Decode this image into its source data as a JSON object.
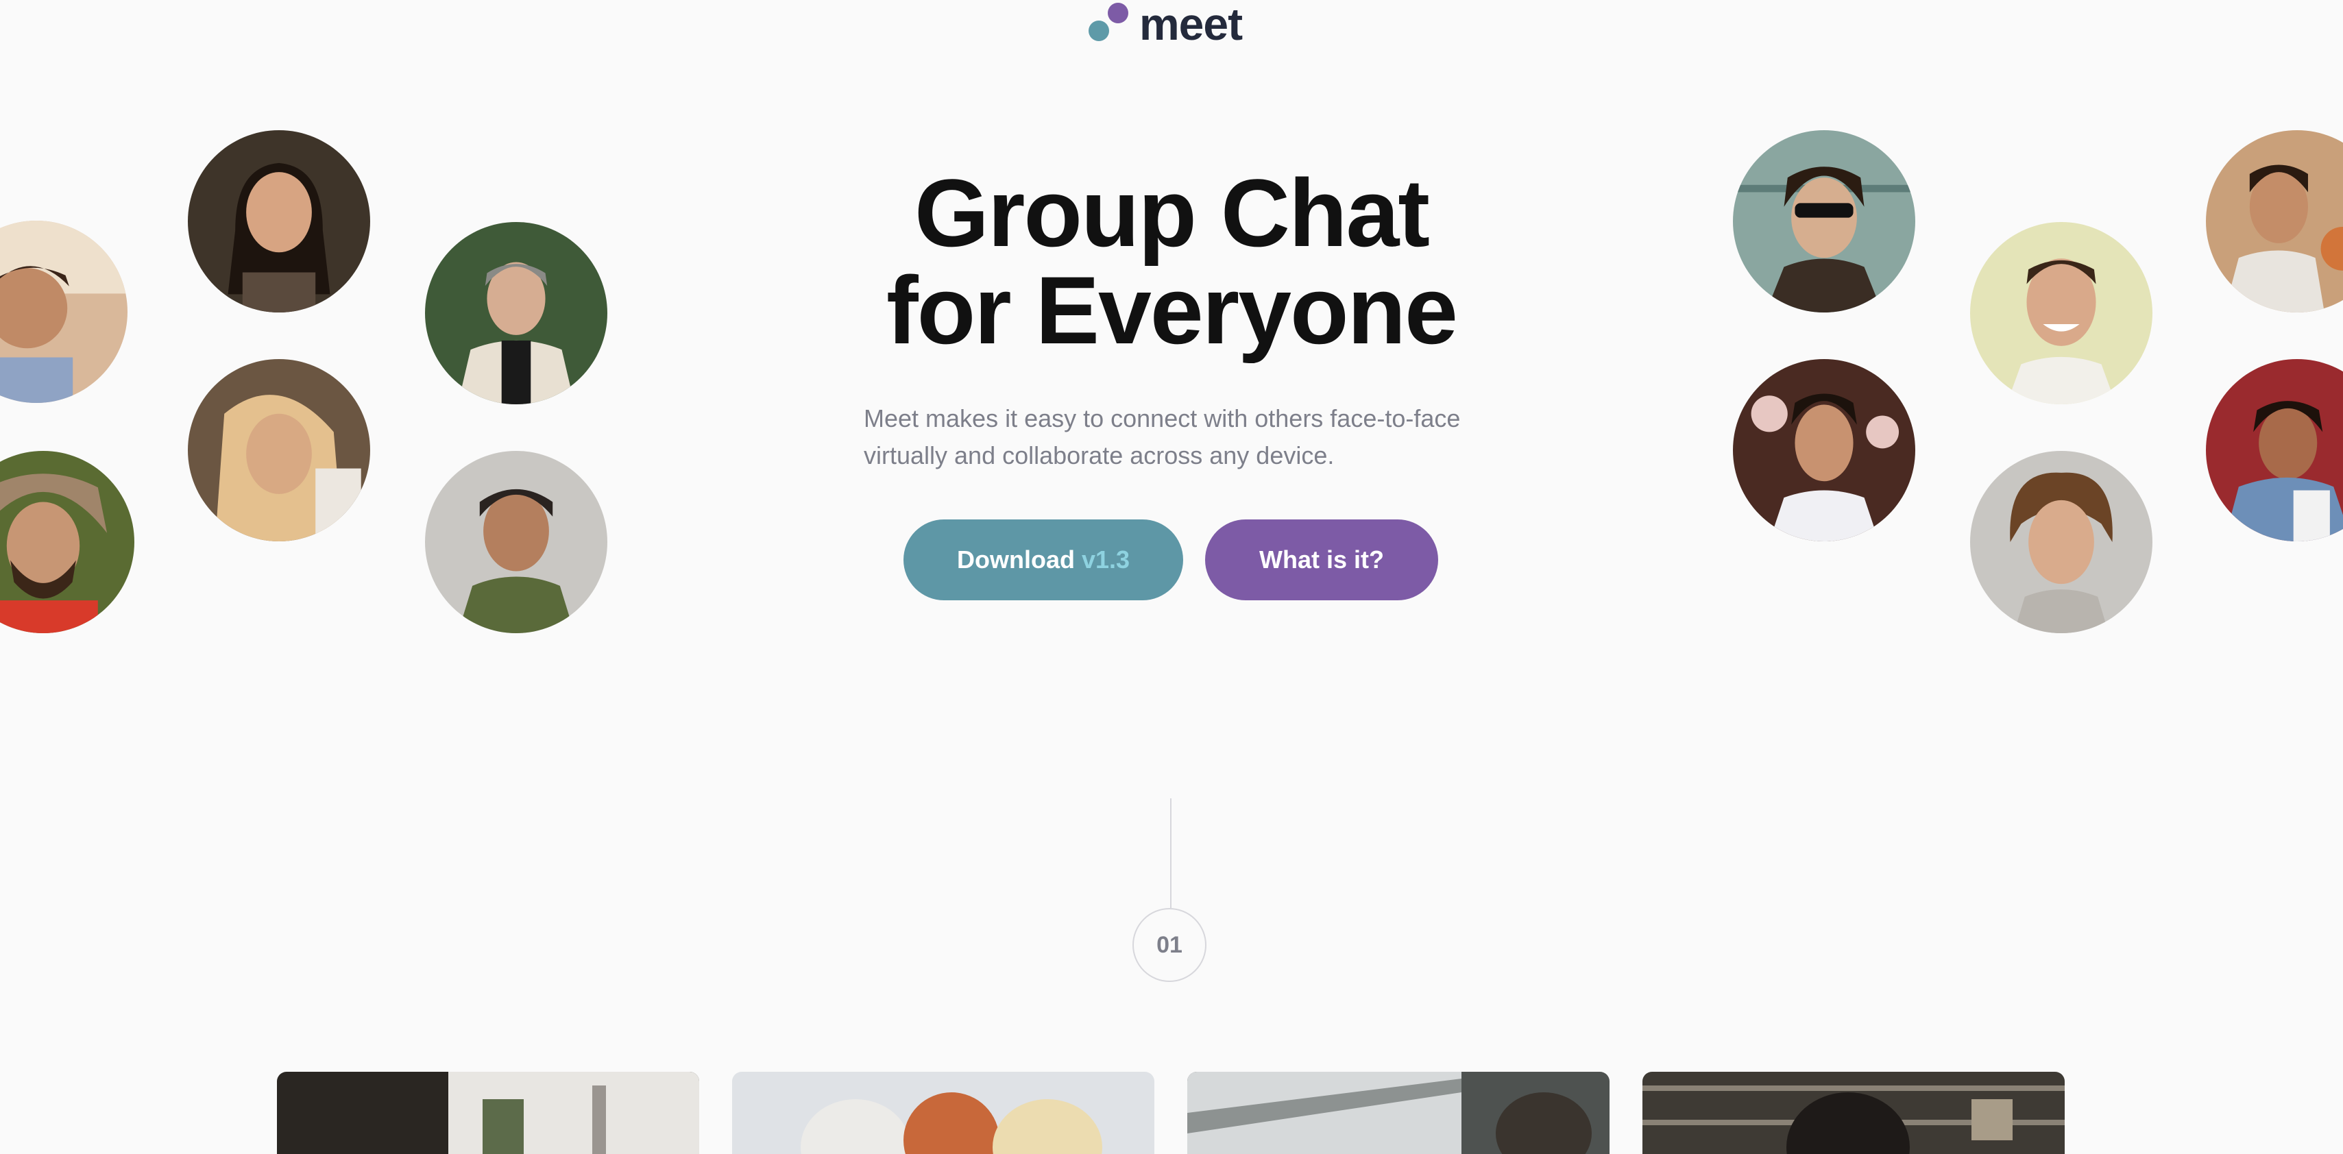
{
  "brand": {
    "name": "meet",
    "teal": "#5e9aa8",
    "purple": "#7d5ba6"
  },
  "hero": {
    "title_line1": "Group Chat",
    "title_line2": "for Everyone",
    "subtitle_line1": "Meet makes it easy to connect with others face-to-face",
    "subtitle_line2": "virtually and collaborate across any device."
  },
  "buttons": {
    "download_label": "Download",
    "download_version": "v1.3",
    "what_label": "What is it?"
  },
  "step": {
    "number": "01"
  },
  "avatars": [
    "person-photo",
    "person-photo",
    "person-photo",
    "person-photo",
    "person-photo",
    "person-photo",
    "person-photo",
    "person-photo",
    "person-photo",
    "person-photo",
    "person-photo",
    "person-photo"
  ]
}
